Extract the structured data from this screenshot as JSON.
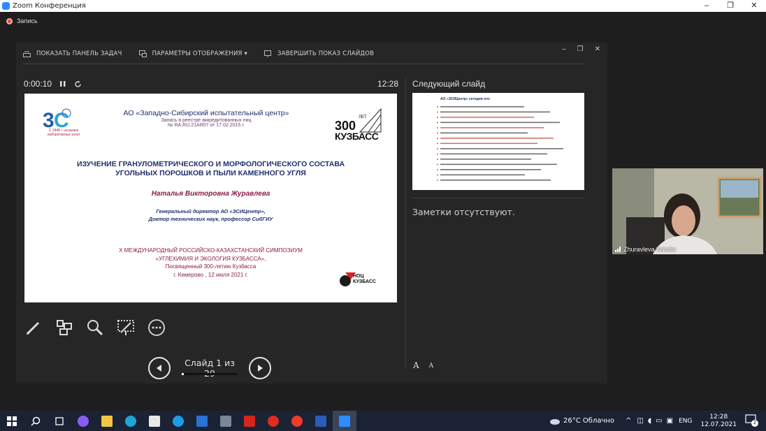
{
  "window": {
    "title": "Zoom Конференция",
    "minimize": "–",
    "maximize": "❐",
    "close": "✕"
  },
  "recording": {
    "label": "Запись"
  },
  "presenter_toolbar": {
    "show_taskbar": "ПОКАЗАТЬ ПАНЕЛЬ ЗАДАЧ",
    "display_settings": "ПАРАМЕТРЫ ОТОБРАЖЕНИЯ ▾",
    "end_show": "ЗАВЕРШИТЬ ПОКАЗ СЛАЙДОВ"
  },
  "timer": {
    "elapsed": "0:00:10",
    "clock": "12:28"
  },
  "slide": {
    "org_name": "АО «Западно-Сибирский испытательный центр»",
    "registry": "Запись в реестре аккредитованных лиц",
    "registry_no": "№ RA.RU.21АЯ07 от 17.02.2015 г.",
    "logo_left_text": "ЗС",
    "logo_left_caption1": "С 1948 г. на рынке",
    "logo_left_caption2": "лабораторных услуг",
    "logo_right_number": "300",
    "logo_right_sup": "ЛЕТ",
    "logo_right_text": "КУЗБАСС",
    "title_line1": "ИЗУЧЕНИЕ ГРАНУЛОМЕТРИЧЕСКОГО И МОРФОЛОГИЧЕСКОГО СОСТАВА",
    "title_line2": "УГОЛЬНЫХ ПОРОШКОВ И ПЫЛИ КАМЕННОГО УГЛЯ",
    "author": "Наталья Викторовна Журавлева",
    "position1": "Генеральный директор АО «ЗСИЦентр»,",
    "position2": "Доктор технических наук, профессор СибГИУ",
    "symp1": "X МЕЖДУНАРОДНЫЙ РОССИЙСКО-КАЗАХСТАНСКИЙ СИМПОЗИУМ",
    "symp2": "«УГЛЕХИМИЯ И ЭКОЛОГИЯ КУЗБАССА»,",
    "symp3": "Посвященный 300-летию Кузбасса",
    "symp4": "г. Кемерово , 12 июля 2021 г.",
    "noc1": "НОЦ",
    "noc2": "КУЗБАСС"
  },
  "next_slide": {
    "header": "Следующий слайд",
    "mini_title": "АО «ЗСИЦентр» сегодня это:"
  },
  "notes": {
    "text": "Заметки отсутствуют."
  },
  "font_buttons": {
    "increase": "A",
    "decrease": "A"
  },
  "navigation": {
    "counter": "Слайд 1 из 29",
    "progress": 0.034
  },
  "video": {
    "participant": "Zhuravleva Natalia"
  },
  "taskbar": {
    "weather": "26°C  Облачно",
    "lang": "ENG",
    "time": "12:28",
    "date": "12.07.2021",
    "notif_count": "2"
  },
  "colors": {
    "slide_navy": "#1f2f6e",
    "slide_maroon": "#8b1d4a",
    "zoom_blue": "#2d8cff"
  }
}
